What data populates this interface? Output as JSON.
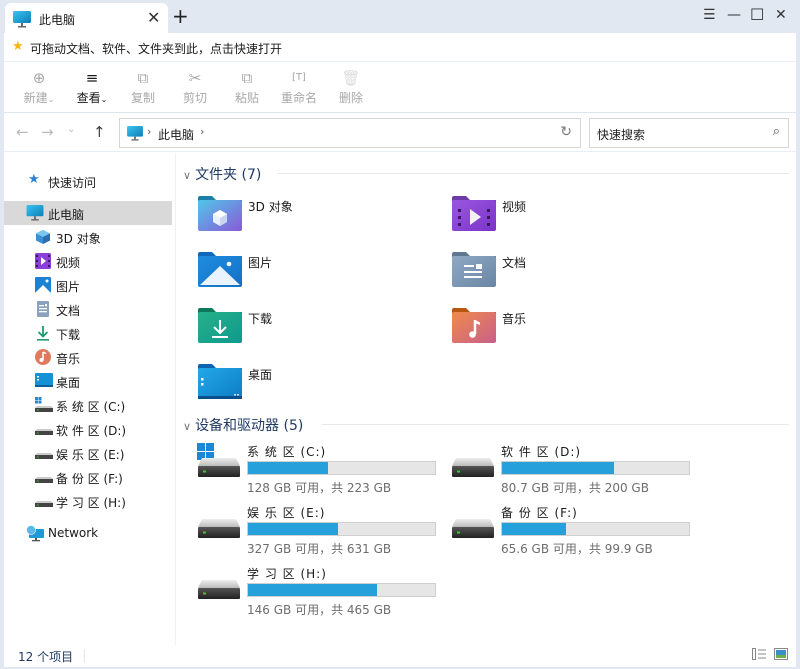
{
  "window": {
    "tab_title": "此电脑",
    "tab_icon": "monitor-icon",
    "new_tab": "+",
    "close_tab": "✕",
    "controls": {
      "menu": "☰",
      "minimize": "—",
      "maximize": "☐",
      "close": "✕"
    }
  },
  "hint": {
    "text": "可拖动文档、软件、文件夹到此，点击快速打开",
    "icon": "star-icon"
  },
  "toolbar": [
    {
      "id": "new",
      "label": "新建",
      "glyph": "⊕",
      "dropdown": true,
      "enabled": false
    },
    {
      "id": "view",
      "label": "查看",
      "glyph": "≡",
      "dropdown": true,
      "enabled": true
    },
    {
      "id": "copy",
      "label": "复制",
      "glyph": "⧉",
      "dropdown": false,
      "enabled": false
    },
    {
      "id": "cut",
      "label": "剪切",
      "glyph": "✂",
      "dropdown": false,
      "enabled": false
    },
    {
      "id": "paste",
      "label": "粘贴",
      "glyph": "⧉",
      "dropdown": false,
      "enabled": false
    },
    {
      "id": "rename",
      "label": "重命名",
      "glyph": "[T]",
      "dropdown": false,
      "enabled": false
    },
    {
      "id": "delete",
      "label": "删除",
      "glyph": "🗑",
      "dropdown": false,
      "enabled": false
    }
  ],
  "nav": {
    "back": "←",
    "forward": "→",
    "recent": "⌄",
    "up": "↑",
    "refresh": "↻"
  },
  "address": {
    "breadcrumb": [
      "此电脑"
    ],
    "separator": "›"
  },
  "search": {
    "placeholder": "快速搜索",
    "icon": "⚲"
  },
  "sidebar": {
    "quick_access": "快速访问",
    "this_pc": "此电脑",
    "items": [
      {
        "label": "3D 对象",
        "icon": "3d-objects-icon"
      },
      {
        "label": "视频",
        "icon": "video-icon"
      },
      {
        "label": "图片",
        "icon": "pictures-icon"
      },
      {
        "label": "文档",
        "icon": "documents-icon"
      },
      {
        "label": "下载",
        "icon": "download-icon"
      },
      {
        "label": "音乐",
        "icon": "music-icon"
      },
      {
        "label": "桌面",
        "icon": "desktop-icon"
      },
      {
        "label": "系 统 区 (C:)",
        "icon": "system-drive-icon"
      },
      {
        "label": "软 件 区 (D:)",
        "icon": "drive-icon"
      },
      {
        "label": "娱 乐 区 (E:)",
        "icon": "drive-icon"
      },
      {
        "label": "备 份 区 (F:)",
        "icon": "drive-icon"
      },
      {
        "label": "学 习 区 (H:)",
        "icon": "drive-icon"
      }
    ],
    "network": "Network"
  },
  "folders": {
    "header": "文件夹 (7)",
    "items": [
      {
        "label": "3D 对象",
        "icon": "3d-objects-folder-icon"
      },
      {
        "label": "视频",
        "icon": "video-folder-icon"
      },
      {
        "label": "图片",
        "icon": "pictures-folder-icon"
      },
      {
        "label": "文档",
        "icon": "documents-folder-icon"
      },
      {
        "label": "下载",
        "icon": "download-folder-icon"
      },
      {
        "label": "音乐",
        "icon": "music-folder-icon"
      },
      {
        "label": "桌面",
        "icon": "desktop-folder-icon"
      }
    ]
  },
  "drives": {
    "header": "设备和驱动器 (5)",
    "items": [
      {
        "name": "系 统 区 (C:)",
        "free": "128 GB",
        "total": "223 GB",
        "status": "128 GB 可用，共 223 GB",
        "used_fraction": 0.43,
        "system": true
      },
      {
        "name": "软 件 区 (D:)",
        "free": "80.7 GB",
        "total": "200 GB",
        "status": "80.7 GB 可用，共 200 GB",
        "used_fraction": 0.6,
        "system": false
      },
      {
        "name": "娱 乐 区 (E:)",
        "free": "327 GB",
        "total": "631 GB",
        "status": "327 GB 可用，共 631 GB",
        "used_fraction": 0.48,
        "system": false
      },
      {
        "name": "备 份 区 (F:)",
        "free": "65.6 GB",
        "total": "99.9 GB",
        "status": "65.6 GB 可用，共 99.9 GB",
        "used_fraction": 0.34,
        "system": false
      },
      {
        "name": "学 习 区 (H:)",
        "free": "146 GB",
        "total": "465 GB",
        "status": "146 GB 可用，共 465 GB",
        "used_fraction": 0.69,
        "system": false
      }
    ]
  },
  "status": {
    "count": "12 个项目"
  },
  "colors": {
    "accent": "#26a0da",
    "titlebar": "#e1e8f1",
    "header_text": "#1f3a63"
  }
}
